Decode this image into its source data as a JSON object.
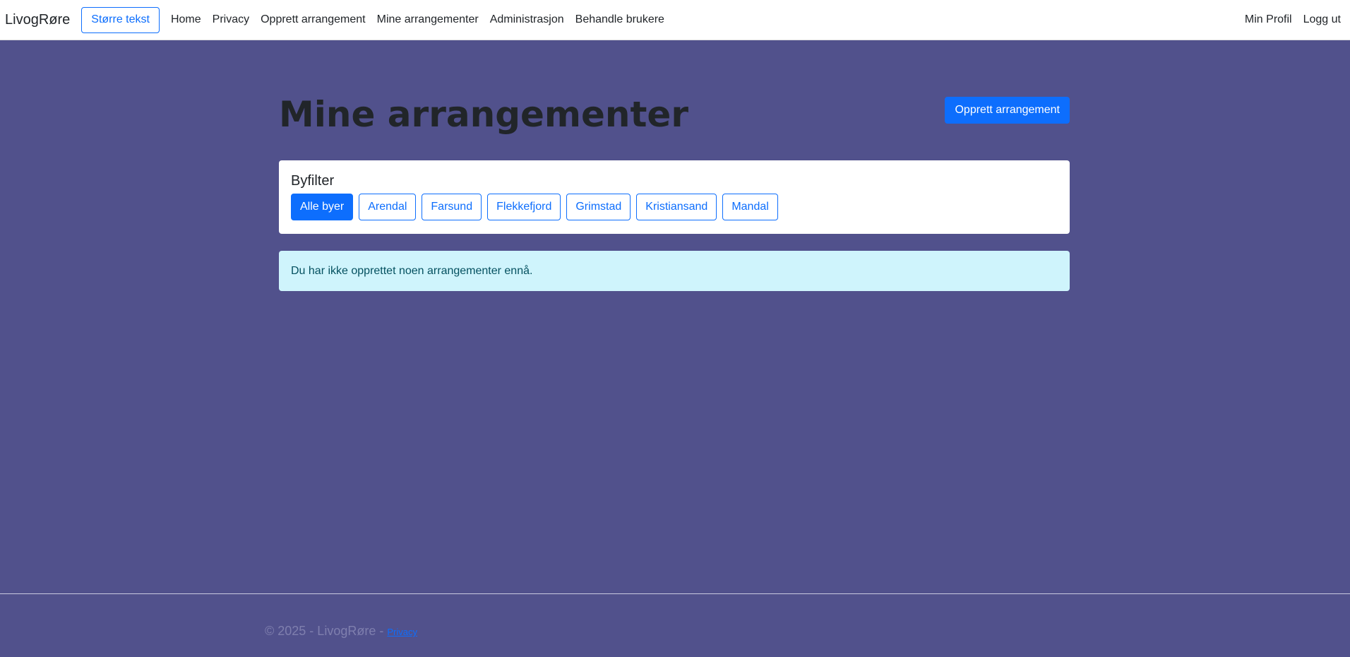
{
  "nav": {
    "brand": "LivogRøre",
    "larger_text": "Større tekst",
    "links": [
      "Home",
      "Privacy",
      "Opprett arrangement",
      "Mine arrangementer",
      "Administrasjon",
      "Behandle brukere"
    ],
    "right": [
      "Min Profil",
      "Logg ut"
    ]
  },
  "main": {
    "title": "Mine arrangementer",
    "create_button": "Opprett arrangement",
    "filter": {
      "title": "Byfilter",
      "buttons": [
        "Alle byer",
        "Arendal",
        "Farsund",
        "Flekkefjord",
        "Grimstad",
        "Kristiansand",
        "Mandal"
      ],
      "active": "Alle byer"
    },
    "empty_message": "Du har ikke opprettet noen arrangementer ennå."
  },
  "footer": {
    "text": "© 2025 - LivogRøre - ",
    "privacy_link": "Privacy"
  },
  "colors": {
    "background": "#51518c",
    "primary": "#0d6efd",
    "info_bg": "#cff4fc",
    "info_text": "#055160"
  }
}
